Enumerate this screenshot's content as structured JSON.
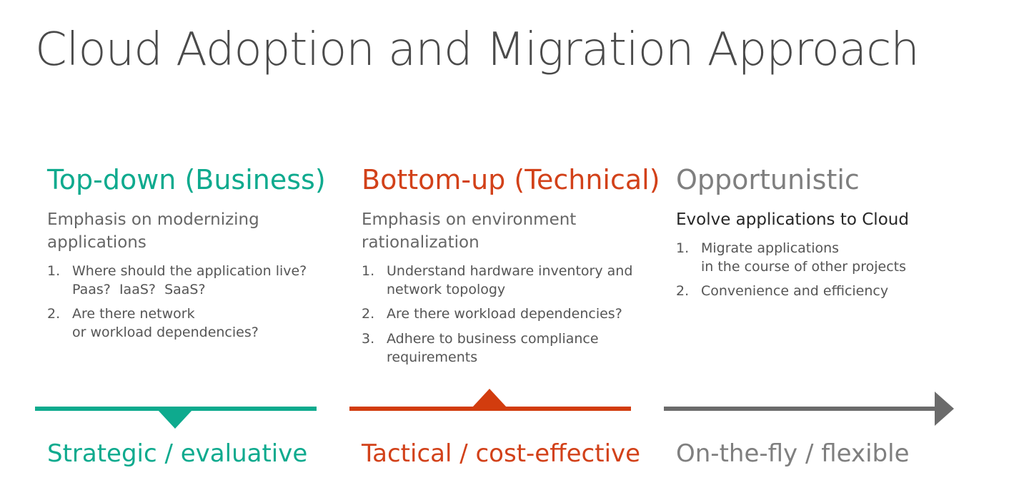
{
  "title": "Cloud Adoption and Migration Approach",
  "colors": {
    "topdown": "#0eaa8e",
    "bottomup": "#d24119",
    "opportunistic": "#7f7f7f"
  },
  "columns": [
    {
      "heading": "Top-down (Business)",
      "subtitle": "Emphasis on modernizing applications",
      "items": [
        {
          "num": "1.",
          "lines": [
            "Where should the application live?",
            "Paas?  IaaS?  SaaS?"
          ]
        },
        {
          "num": "2.",
          "lines": [
            "Are there network",
            "or workload dependencies?"
          ]
        }
      ],
      "footer": "Strategic / evaluative",
      "indicator": "triangle-down-icon"
    },
    {
      "heading": "Bottom-up (Technical)",
      "subtitle": "Emphasis on environment rationalization",
      "items": [
        {
          "num": "1.",
          "lines": [
            "Understand hardware inventory and",
            "network topology"
          ]
        },
        {
          "num": "2.",
          "lines": [
            "Are there workload dependencies?"
          ]
        },
        {
          "num": "3.",
          "lines": [
            "Adhere to business compliance",
            "requirements"
          ]
        }
      ],
      "footer": "Tactical / cost-effective",
      "indicator": "triangle-up-icon"
    },
    {
      "heading": "Opportunistic",
      "subtitle": "Evolve applications to Cloud",
      "items": [
        {
          "num": "1.",
          "lines": [
            "Migrate applications",
            "in the course of other projects"
          ]
        },
        {
          "num": "2.",
          "lines": [
            "Convenience and efficiency"
          ]
        }
      ],
      "footer": "On-the-fly / flexible",
      "indicator": "arrow-right-icon"
    }
  ]
}
